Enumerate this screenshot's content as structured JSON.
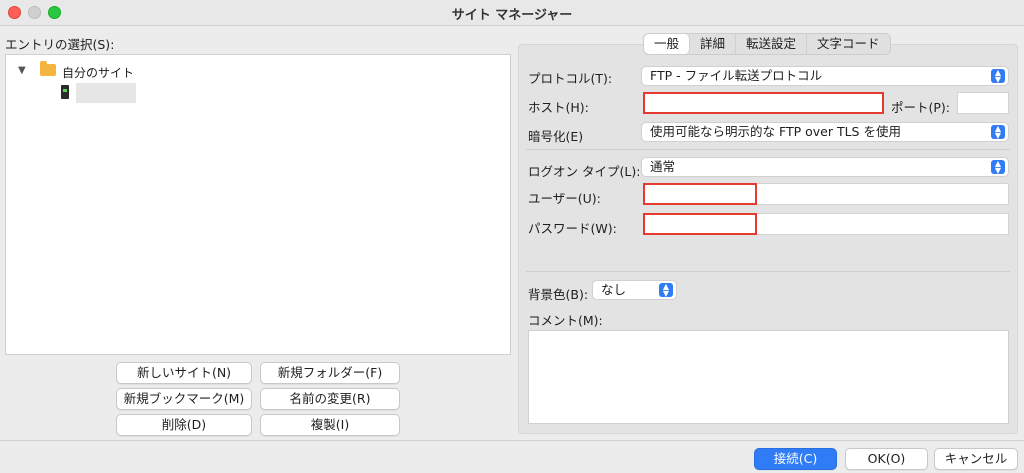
{
  "window": {
    "title": "サイト マネージャー"
  },
  "entries": {
    "label": "エントリの選択(S):",
    "folder_label": "自分のサイト"
  },
  "left_buttons": {
    "new_site": "新しいサイト(N)",
    "new_folder": "新規フォルダー(F)",
    "new_bookmark": "新規ブックマーク(M)",
    "rename": "名前の変更(R)",
    "delete": "削除(D)",
    "duplicate": "複製(I)"
  },
  "tabs": [
    "一般",
    "詳細",
    "転送設定",
    "文字コード"
  ],
  "general": {
    "protocol_label": "プロトコル(T):",
    "protocol_value": "FTP - ファイル転送プロトコル",
    "host_label": "ホスト(H):",
    "host_value": "",
    "port_label": "ポート(P):",
    "port_value": "",
    "encryption_label": "暗号化(E)",
    "encryption_value": "使用可能なら明示的な FTP over TLS を使用",
    "logon_label": "ログオン タイプ(L):",
    "logon_value": "通常",
    "user_label": "ユーザー(U):",
    "user_value": "",
    "password_label": "パスワード(W):",
    "password_value": "",
    "bg_label": "背景色(B):",
    "bg_value": "なし",
    "comment_label": "コメント(M):"
  },
  "footer": {
    "connect": "接続(C)",
    "ok": "OK(O)",
    "cancel": "キャンセル"
  },
  "colors": {
    "accent": "#2f7cf6",
    "highlight_border": "#e53a2f"
  }
}
